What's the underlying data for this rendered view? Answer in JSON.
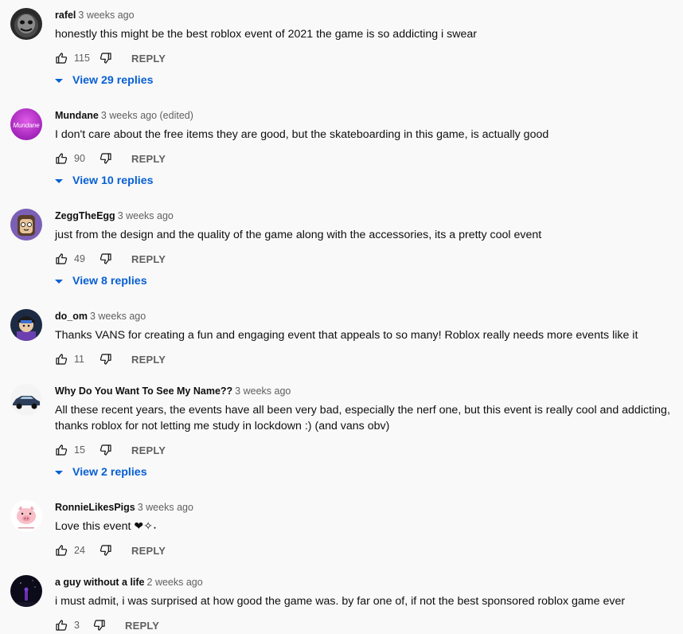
{
  "comments": [
    {
      "author": "rafel",
      "time": "3 weeks ago",
      "text": "honestly this might be the best roblox event of 2021 the game is so addicting i swear",
      "likes": "115",
      "reply_label": "REPLY",
      "replies_label": "View 29 replies",
      "avatar": "dark-masked-character-avatar"
    },
    {
      "author": "Mundane",
      "time": "3 weeks ago (edited)",
      "text": "I don't care about the free items they are good, but the skateboarding in this game, is actually good",
      "likes": "90",
      "reply_label": "REPLY",
      "replies_label": "View 10 replies",
      "avatar": "purple-mundane-logo-avatar",
      "avatar_text": "Mundane"
    },
    {
      "author": "ZeggTheEgg",
      "time": "3 weeks ago",
      "text": "just from the design and the quality of the game along with the accessories, its a pretty cool event",
      "likes": "49",
      "reply_label": "REPLY",
      "replies_label": "View 8 replies",
      "avatar": "purple-cartoon-face-avatar"
    },
    {
      "author": "do_om",
      "time": "3 weeks ago",
      "text": "Thanks VANS for creating a fun and engaging event that appeals to so many!  Roblox really needs more events like it",
      "likes": "11",
      "reply_label": "REPLY",
      "avatar": "capped-character-avatar"
    },
    {
      "author": "Why Do You Want To See My Name??",
      "time": "3 weeks ago",
      "text": "All these recent years, the events have all been very bad, especially the nerf one, but this event is really cool and addicting, thanks roblox for not letting me study in lockdown :) (and vans obv)",
      "likes": "15",
      "reply_label": "REPLY",
      "replies_label": "View 2 replies",
      "avatar": "car-avatar"
    },
    {
      "author": "RonnieLikesPigs",
      "time": "3 weeks ago",
      "text": "Love this event ❤︎✧˖",
      "likes": "24",
      "reply_label": "REPLY",
      "avatar": "pig-avatar"
    },
    {
      "author": "a guy without a life",
      "time": "2 weeks ago",
      "text": "i must admit, i was surprised at how good the game was. by far one of, if not the best sponsored roblox game ever",
      "likes": "3",
      "reply_label": "REPLY",
      "avatar": "dark-night-avatar"
    }
  ],
  "colors": {
    "link": "#065fd4",
    "meta": "#606060",
    "text": "#0f0f0f",
    "background": "#f9f9f9"
  }
}
